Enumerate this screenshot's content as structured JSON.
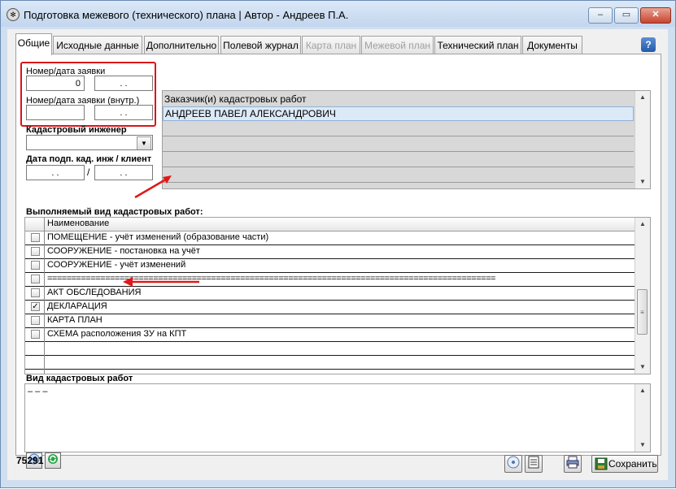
{
  "window": {
    "title": "Подготовка межевого (технического) плана | Автор - Андреев П.А.",
    "minimize_glyph": "‒",
    "restore_glyph": "▭",
    "close_glyph": "✕"
  },
  "tabs": [
    {
      "label": "Общие",
      "active": true,
      "enabled": true
    },
    {
      "label": "Исходные данные",
      "active": false,
      "enabled": true
    },
    {
      "label": "Дополнительно",
      "active": false,
      "enabled": true
    },
    {
      "label": "Полевой журнал",
      "active": false,
      "enabled": true
    },
    {
      "label": "Карта план",
      "active": false,
      "enabled": false
    },
    {
      "label": "Межевой план",
      "active": false,
      "enabled": false
    },
    {
      "label": "Технический план",
      "active": false,
      "enabled": true
    },
    {
      "label": "Документы",
      "active": false,
      "enabled": true
    }
  ],
  "help_label": "?",
  "form": {
    "request_label": "Номер/дата заявки",
    "request_number": "0",
    "request_date": ". .",
    "request_internal_label": "Номер/дата заявки (внутр.)",
    "request_internal_number": "",
    "request_internal_date": ". .",
    "engineer_label": "Кадастровый инженер",
    "engineer_value": "",
    "sign_date_label": "Дата подп. кад. инж / клиент",
    "sign_date_engineer": ". .",
    "sign_date_separator": "/",
    "sign_date_client": ". .",
    "customer_label": "Заказчик(и) кадастровых работ",
    "customers": [
      "АНДРЕЕВ ПАВЕЛ АЛЕКСАНДРОВИЧ",
      "",
      "",
      "",
      ""
    ],
    "works_label": "Выполняемый вид кадастровых работ:",
    "works_column_header": "Наименование",
    "works": [
      {
        "name": "ПОМЕЩЕНИЕ - учёт изменений (образование части)",
        "checked": false
      },
      {
        "name": "СООРУЖЕНИЕ - постановка на учёт",
        "checked": false
      },
      {
        "name": "СООРУЖЕНИЕ - учёт изменений",
        "checked": false
      },
      {
        "name": "=============================================================================================",
        "checked": false
      },
      {
        "name": "АКТ ОБСЛЕДОВАНИЯ",
        "checked": false
      },
      {
        "name": "ДЕКЛАРАЦИЯ",
        "checked": true
      },
      {
        "name": "КАРТА ПЛАН",
        "checked": false
      },
      {
        "name": "СХЕМА расположения ЗУ на КПТ",
        "checked": false
      }
    ],
    "work_type_label": "Вид кадастровых работ",
    "work_type_value": "– – –"
  },
  "footer": {
    "record_id": "75291",
    "save_label": "Сохранить"
  },
  "colors": {
    "accent_red": "#d9141a",
    "selection_blue": "#dce9f7"
  },
  "icons": [
    "app-icon",
    "list-icon",
    "delete-icon",
    "back-icon",
    "refresh-icon",
    "disc-icon",
    "document-icon",
    "printer-icon",
    "save-icon",
    "combo-arrow-icon",
    "help-icon"
  ]
}
